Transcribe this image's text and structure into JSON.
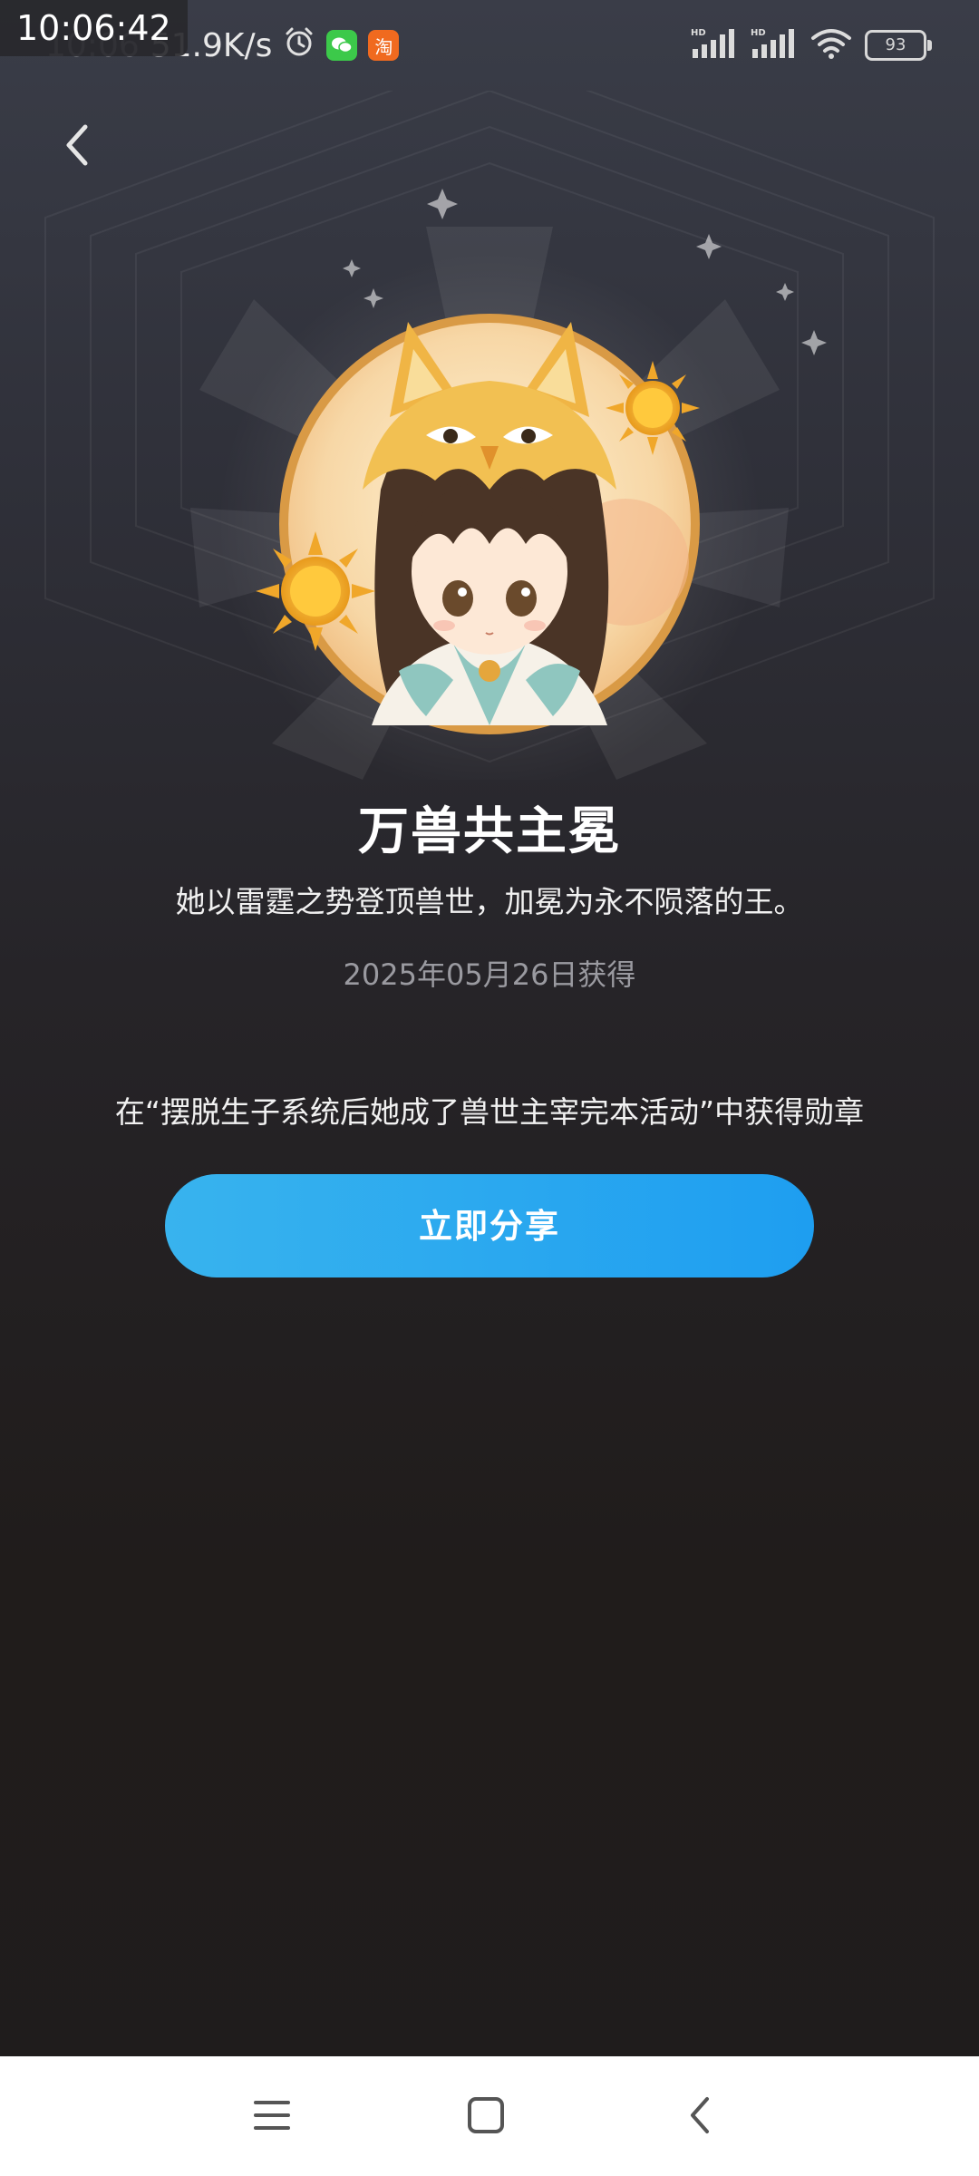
{
  "status_bar": {
    "overlay_time": "10:06:42",
    "clock": "10:06",
    "network_speed": "51.9K/s",
    "battery_level": "93",
    "signal_1_label": "HD",
    "signal_2_label": "HD",
    "icons": [
      "alarm-icon",
      "wechat-icon",
      "taobao-icon",
      "signal-icon",
      "signal-icon",
      "wifi-icon",
      "battery-icon"
    ],
    "taobao_glyph": "淘"
  },
  "header": {
    "back_icon": "chevron-left-icon"
  },
  "badge": {
    "title": "万兽共主冕",
    "description": "她以雷霆之势登顶兽世，加冕为永不陨落的王。",
    "obtained_date": "2025年05月26日获得",
    "source": "在“摆脱生子系统后她成了兽世主宰完本活动”中获得勋章",
    "image": "badge-character-portrait"
  },
  "actions": {
    "share_label": "立即分享"
  },
  "nav_bar": {
    "icons": [
      "menu-icon",
      "home-square-icon",
      "back-icon"
    ]
  },
  "colors": {
    "accent_blue_start": "#38b3ee",
    "accent_blue_end": "#1e9ef0",
    "badge_gold": "#e8a64b",
    "date_gray": "#9a9aa0"
  }
}
